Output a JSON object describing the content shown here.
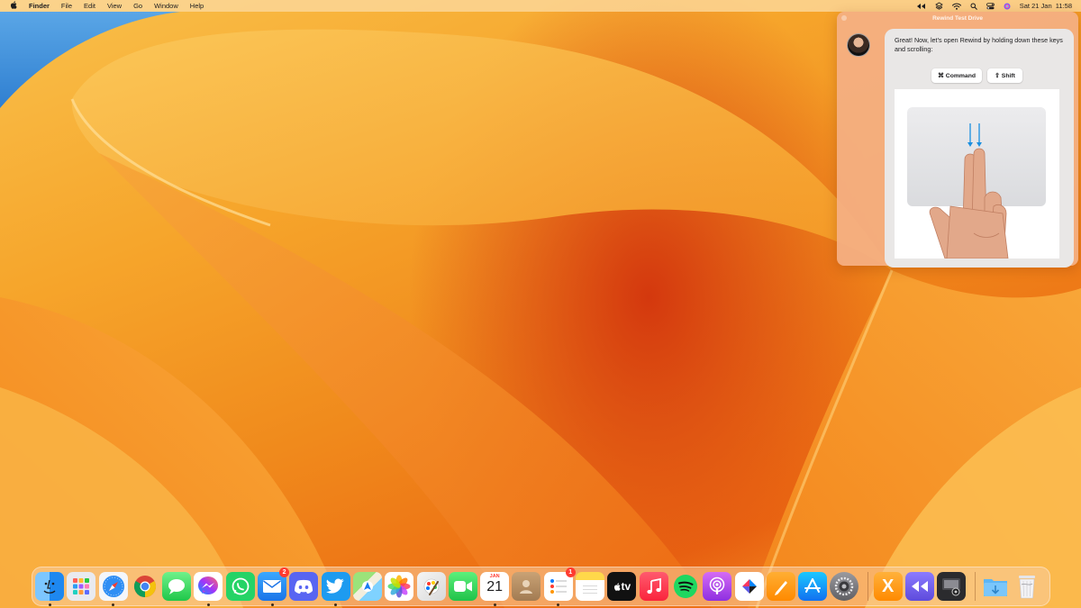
{
  "menubar": {
    "apple_glyph": "",
    "app_name": "Finder",
    "menus": [
      "File",
      "Edit",
      "View",
      "Go",
      "Window",
      "Help"
    ],
    "status_icons": [
      "rewind-icon",
      "layers-icon",
      "wifi-icon",
      "search-icon",
      "control-center-icon",
      "siri-icon"
    ],
    "datetime": "Sat 21 Jan  11:58"
  },
  "rewind_panel": {
    "title": "Rewind Test Drive",
    "message": "Great! Now, let’s open Rewind by holding down these keys and scrolling:",
    "keys": {
      "command": {
        "glyph": "⌘",
        "label": "Command"
      },
      "shift": {
        "glyph": "⇧",
        "label": "Shift"
      }
    },
    "illustration": "two-finger-scroll-down-on-trackpad",
    "arrow_color": "#1a8fe0"
  },
  "dock": {
    "apps": [
      {
        "name": "Finder",
        "icon": "finder-icon",
        "running": true
      },
      {
        "name": "Launchpad",
        "icon": "launchpad-icon",
        "running": false
      },
      {
        "name": "Safari",
        "icon": "safari-icon",
        "running": true
      },
      {
        "name": "Chrome",
        "icon": "chrome-icon",
        "running": false
      },
      {
        "name": "Messages",
        "icon": "messages-icon",
        "running": false
      },
      {
        "name": "Messenger",
        "icon": "messenger-icon",
        "running": true
      },
      {
        "name": "WhatsApp",
        "icon": "whatsapp-icon",
        "running": false
      },
      {
        "name": "Mail",
        "icon": "mail-icon",
        "running": true,
        "badge": "2"
      },
      {
        "name": "Discord",
        "icon": "discord-icon",
        "running": false
      },
      {
        "name": "Twitter",
        "icon": "twitter-icon",
        "running": true
      },
      {
        "name": "Maps",
        "icon": "maps-icon",
        "running": false
      },
      {
        "name": "Photos",
        "icon": "photos-icon",
        "running": false
      },
      {
        "name": "Pixelmator",
        "icon": "pixelmator-icon",
        "running": false
      },
      {
        "name": "FaceTime",
        "icon": "facetime-icon",
        "running": false
      },
      {
        "name": "Calendar",
        "icon": "calendar-icon",
        "running": true,
        "month": "JAN",
        "day": "21"
      },
      {
        "name": "Contacts",
        "icon": "contacts-icon",
        "running": false
      },
      {
        "name": "Reminders",
        "icon": "reminders-icon",
        "running": true,
        "badge": "1"
      },
      {
        "name": "Notes",
        "icon": "notes-icon",
        "running": false
      },
      {
        "name": "Apple TV",
        "icon": "appletv-icon",
        "running": false,
        "label": "tv"
      },
      {
        "name": "Music",
        "icon": "music-icon",
        "running": false
      },
      {
        "name": "Spotify",
        "icon": "spotify-icon",
        "running": false
      },
      {
        "name": "Podcasts",
        "icon": "podcasts-icon",
        "running": false
      },
      {
        "name": "Craft",
        "icon": "craft-icon",
        "running": false
      },
      {
        "name": "Pages",
        "icon": "pages-icon",
        "running": false
      },
      {
        "name": "App Store",
        "icon": "appstore-icon",
        "running": false
      },
      {
        "name": "System Settings",
        "icon": "settings-icon",
        "running": false
      }
    ],
    "apps_secondary": [
      {
        "name": "XQuartz",
        "icon": "x-app-icon",
        "running": false
      },
      {
        "name": "Rewind",
        "icon": "rewind-app-icon",
        "running": false
      },
      {
        "name": "Screenshot Utility",
        "icon": "screenshot-app-icon",
        "running": false
      }
    ],
    "stacks": [
      {
        "name": "Downloads",
        "icon": "downloads-folder-icon"
      },
      {
        "name": "Trash",
        "icon": "trash-icon"
      }
    ]
  }
}
